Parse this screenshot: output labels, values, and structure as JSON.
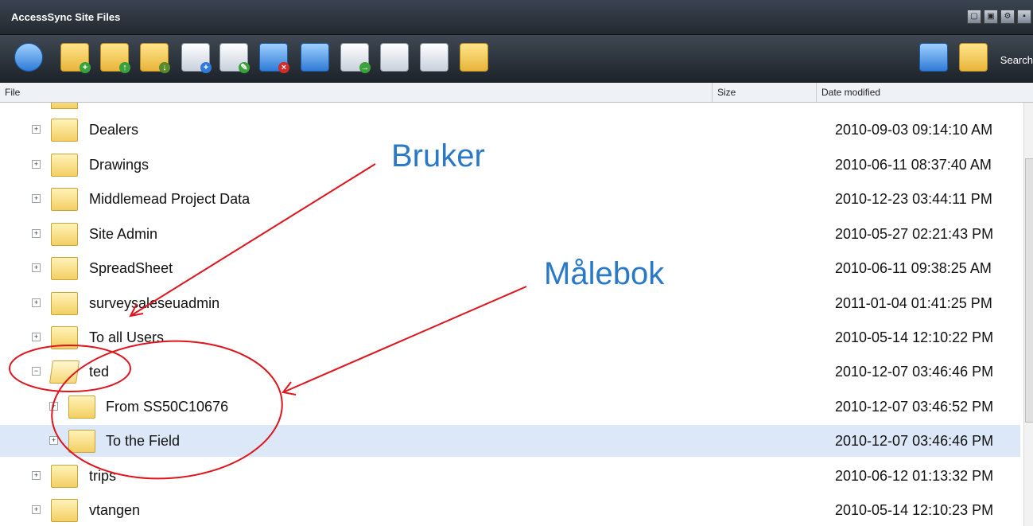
{
  "window": {
    "title": "AccessSync Site Files",
    "controls": [
      "▢",
      "▣",
      "⚙",
      "▪"
    ]
  },
  "toolbar": {
    "search_label": "Search",
    "icons": [
      "refresh-icon",
      "new-folder-icon",
      "upload-folder-icon",
      "download-folder-icon",
      "preview-icon",
      "edit-icon",
      "delete-icon",
      "list-icon",
      "move-icon",
      "history-icon",
      "copy-icon",
      "share-folder-icon"
    ]
  },
  "columns": {
    "file": "File",
    "size": "Size",
    "date": "Date modified"
  },
  "rows": [
    {
      "name": "Dealers",
      "date": "2010-09-03 09:14:10 AM",
      "level": 0,
      "expanded": false
    },
    {
      "name": "Drawings",
      "date": "2010-06-11 08:37:40 AM",
      "level": 0,
      "expanded": false
    },
    {
      "name": "Middlemead Project Data",
      "date": "2010-12-23 03:44:11 PM",
      "level": 0,
      "expanded": false
    },
    {
      "name": "Site Admin",
      "date": "2010-05-27 02:21:43 PM",
      "level": 0,
      "expanded": false
    },
    {
      "name": "SpreadSheet",
      "date": "2010-06-11 09:38:25 AM",
      "level": 0,
      "expanded": false
    },
    {
      "name": "surveysaleseuadmin",
      "date": "2011-01-04 01:41:25 PM",
      "level": 0,
      "expanded": false
    },
    {
      "name": "To all Users",
      "date": "2010-05-14 12:10:22 PM",
      "level": 0,
      "expanded": false
    },
    {
      "name": "ted",
      "date": "2010-12-07 03:46:46 PM",
      "level": 0,
      "expanded": true
    },
    {
      "name": "From SS50C10676",
      "date": "2010-12-07 03:46:52 PM",
      "level": 1,
      "expanded": false
    },
    {
      "name": "To the Field",
      "date": "2010-12-07 03:46:46 PM",
      "level": 1,
      "expanded": false,
      "selected": true
    },
    {
      "name": "trips",
      "date": "2010-06-12 01:13:32 PM",
      "level": 0,
      "expanded": false
    },
    {
      "name": "vtangen",
      "date": "2010-05-14 12:10:23 PM",
      "level": 0,
      "expanded": false
    }
  ],
  "annotations": {
    "user_label": "Bruker",
    "book_label": "Målebok",
    "color": "#e0141c",
    "text_color": "#2a78c8"
  }
}
